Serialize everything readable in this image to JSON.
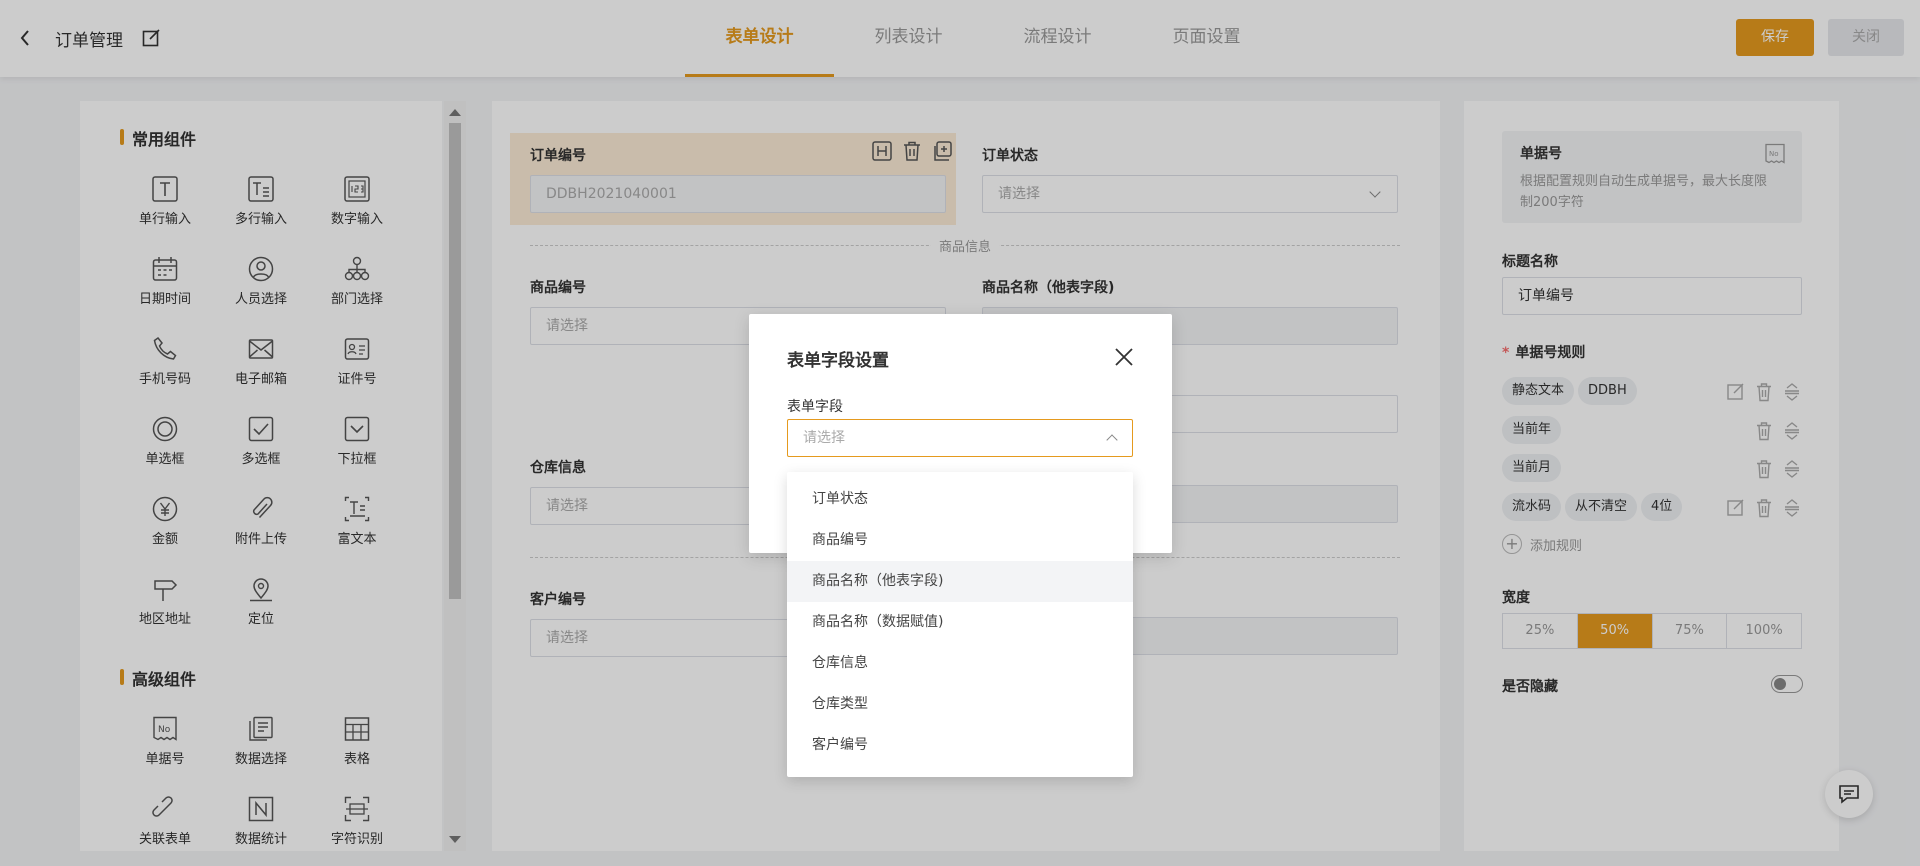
{
  "header": {
    "title": "订单管理",
    "tabs": [
      "表单设计",
      "列表设计",
      "流程设计",
      "页面设置"
    ],
    "active_tab": 0,
    "save_label": "保存",
    "close_label": "关闭"
  },
  "left": {
    "common_title": "常用组件",
    "common": [
      {
        "label": "单行输入",
        "icon": "text-input-icon"
      },
      {
        "label": "多行输入",
        "icon": "textarea-icon"
      },
      {
        "label": "数字输入",
        "icon": "number-input-icon"
      },
      {
        "label": "日期时间",
        "icon": "calendar-icon"
      },
      {
        "label": "人员选择",
        "icon": "user-icon"
      },
      {
        "label": "部门选择",
        "icon": "org-tree-icon"
      },
      {
        "label": "手机号码",
        "icon": "phone-icon"
      },
      {
        "label": "电子邮箱",
        "icon": "mail-icon"
      },
      {
        "label": "证件号",
        "icon": "id-card-icon"
      },
      {
        "label": "单选框",
        "icon": "radio-icon"
      },
      {
        "label": "多选框",
        "icon": "checkbox-icon"
      },
      {
        "label": "下拉框",
        "icon": "dropdown-icon"
      },
      {
        "label": "金额",
        "icon": "yen-icon"
      },
      {
        "label": "附件上传",
        "icon": "paperclip-icon"
      },
      {
        "label": "富文本",
        "icon": "rich-text-icon"
      },
      {
        "label": "地区地址",
        "icon": "signpost-icon"
      },
      {
        "label": "定位",
        "icon": "location-pin-icon"
      }
    ],
    "advanced_title": "高级组件",
    "advanced": [
      {
        "label": "单据号",
        "icon": "serial-number-icon"
      },
      {
        "label": "数据选择",
        "icon": "data-select-icon"
      },
      {
        "label": "表格",
        "icon": "table-icon"
      },
      {
        "label": "关联表单",
        "icon": "link-icon"
      },
      {
        "label": "数据统计",
        "icon": "statistics-icon"
      },
      {
        "label": "字符识别",
        "icon": "ocr-icon"
      }
    ]
  },
  "canvas": {
    "order_no": {
      "label": "订单编号",
      "value": "DDBH2021040001"
    },
    "order_status": {
      "label": "订单状态",
      "placeholder": "请选择"
    },
    "section_goods": "商品信息",
    "goods_no": {
      "label": "商品编号",
      "placeholder": "请选择"
    },
    "goods_name": {
      "label": "商品名称（他表字段)"
    },
    "warehouse": {
      "label": "仓库信息",
      "placeholder": "请选择"
    },
    "customer_no": {
      "label": "客户编号",
      "placeholder": "请选择"
    }
  },
  "right": {
    "info_title": "单据号",
    "info_desc": "根据配置规则自动生成单据号，最大长度限制200字符",
    "title_label": "标题名称",
    "title_value": "订单编号",
    "rule_label": "单据号规则",
    "rules": [
      {
        "tags": [
          "静态文本",
          "DDBH"
        ],
        "editable": true
      },
      {
        "tags": [
          "当前年"
        ],
        "editable": false
      },
      {
        "tags": [
          "当前月"
        ],
        "editable": false
      },
      {
        "tags": [
          "流水码",
          "从不清空",
          "4位"
        ],
        "editable": true
      }
    ],
    "add_rule": "添加规则",
    "width_label": "宽度",
    "widths": [
      "25%",
      "50%",
      "75%",
      "100%"
    ],
    "width_selected": "50%",
    "hidden_label": "是否隐藏",
    "hidden": false
  },
  "modal": {
    "title": "表单字段设置",
    "field_label": "表单字段",
    "placeholder": "请选择",
    "options": [
      "订单状态",
      "商品编号",
      "商品名称（他表字段)",
      "商品名称（数据赋值)",
      "仓库信息",
      "仓库类型",
      "客户编号"
    ],
    "hover_index": 2
  },
  "colors": {
    "accent": "#e59a1e",
    "mask": "rgba(0,0,0,0.2)"
  }
}
